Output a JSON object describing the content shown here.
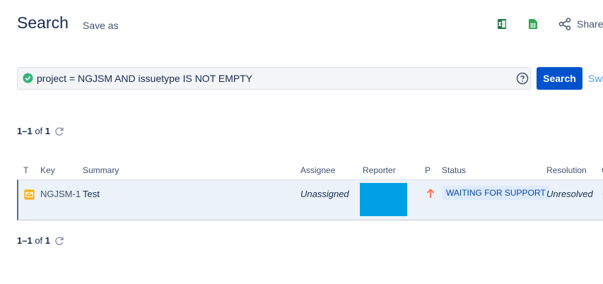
{
  "header": {
    "title": "Search",
    "save_as": "Save as",
    "share": "Share"
  },
  "icons": {
    "export_excel": "excel-icon",
    "export_sheets": "google-sheets-icon",
    "share": "share-icon",
    "query_valid": "check-circle-icon",
    "help": "help-icon",
    "refresh": "refresh-icon",
    "issue_type": "email-request-icon",
    "priority": "arrow-up-icon"
  },
  "query": {
    "text": "project = NGJSM AND issuetype IS NOT EMPTY"
  },
  "search_button": "Search",
  "switch_link": "Swi",
  "pagination": {
    "range": "1–1",
    "of": "of",
    "total": "1"
  },
  "table": {
    "headers": {
      "t": "T",
      "key": "Key",
      "summary": "Summary",
      "assignee": "Assignee",
      "reporter": "Reporter",
      "p": "P",
      "status": "Status",
      "resolution": "Resolution",
      "cut": "C"
    },
    "rows": [
      {
        "key": "NGJSM-1",
        "summary": "Test",
        "assignee": "Unassigned",
        "status": "WAITING FOR SUPPORT",
        "resolution": "Unresolved",
        "cut": "("
      }
    ]
  },
  "colors": {
    "primary": "#0052cc",
    "status_bg": "#deebff",
    "status_text": "#0747a6",
    "row_selected": "#ebf2f9",
    "reporter_block": "#00a1e4",
    "priority": "#ff7452",
    "issue_type": "#ffab00",
    "valid": "#36b37e"
  }
}
